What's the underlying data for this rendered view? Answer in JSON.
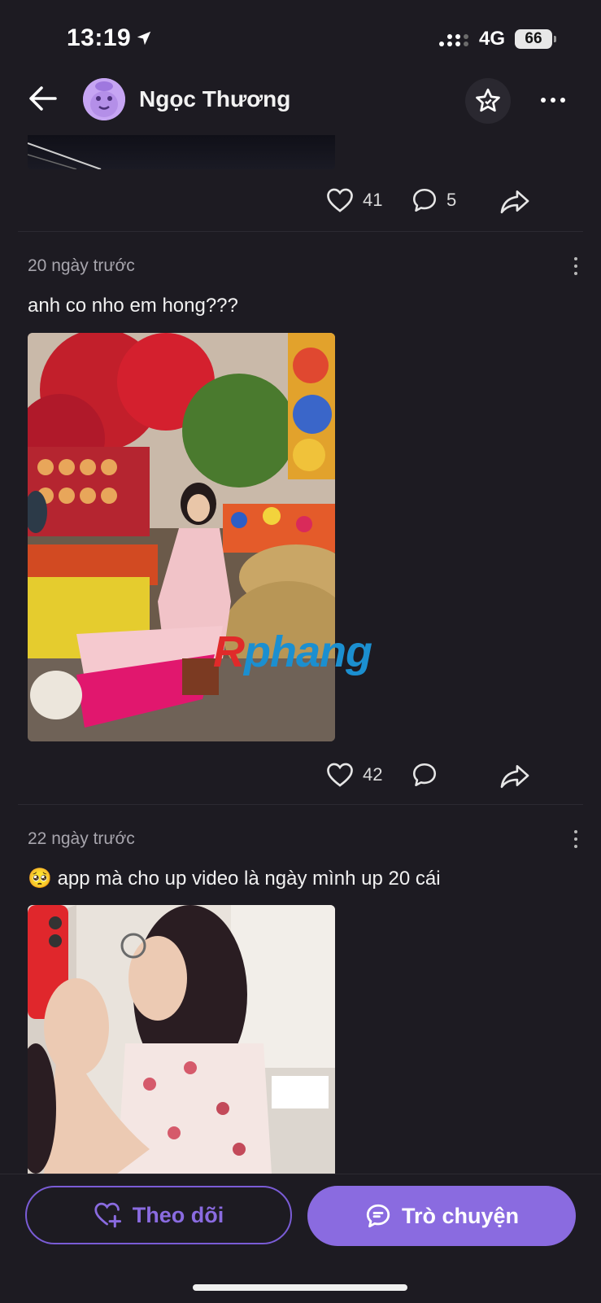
{
  "status_bar": {
    "time": "13:19",
    "network": "4G",
    "battery": "66"
  },
  "header": {
    "username": "Ngọc Thương"
  },
  "post0": {
    "likes": "41",
    "comments": "5"
  },
  "post1": {
    "time_ago": "20 ngày trước",
    "text": "anh co nho em hong???",
    "likes": "42",
    "comments": "",
    "watermark": "phang"
  },
  "post2": {
    "time_ago": "22 ngày trước",
    "emoji": "🥺",
    "text": "app mà cho up video là ngày mình up 20 cái"
  },
  "bottom": {
    "follow_label": "Theo dõi",
    "chat_label": "Trò chuyện"
  },
  "colors": {
    "background": "#1d1b22",
    "accent": "#8a6be0"
  }
}
